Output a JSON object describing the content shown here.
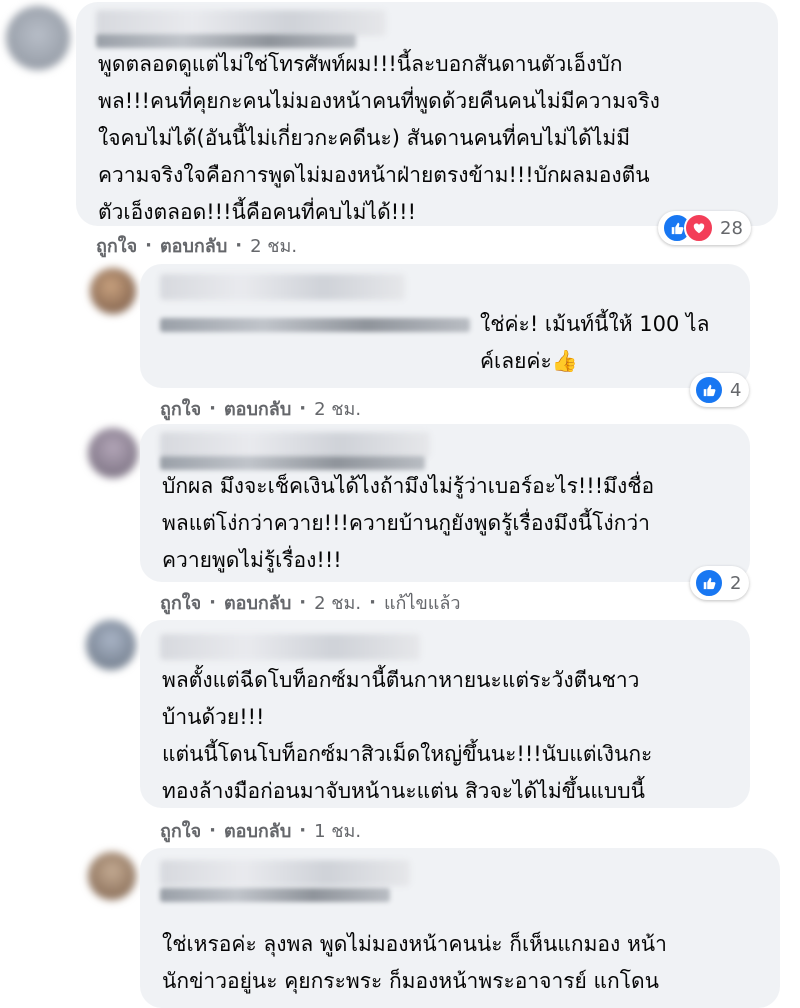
{
  "comments": [
    {
      "text": "พูดตลอดดูแต่ไม่ใช่โทรศัพท์ผม!!!นี้ละบอกสันดานตัวเอ็งบัก\nพล!!!คนที่คุยกะคนไม่มองหน้าคนที่พูดด้วยคืนคนไม่มีความจริง\nใจคบไม่ได้(อันนี้ไม่เกี่ยวกะคดีนะ) สันดานคนที่คบไม่ได้ไม่มี\nความจริงใจคือการพูดไม่มองหน้าฝ่ายตรงข้าม!!!บักผลมองตีน\nตัวเอ็งตลอด!!!นี้คือคนที่คบไม่ได้!!!",
      "reaction_count": "28",
      "like_label": "ถูกใจ",
      "reply_label": "ตอบกลับ",
      "time": "2 ชม.",
      "edited": ""
    },
    {
      "text": "ใช่ค่ะ! เม้นท์นี้ให้ 100 ไล\nค์เลยค่ะ👍",
      "reaction_count": "4",
      "like_label": "ถูกใจ",
      "reply_label": "ตอบกลับ",
      "time": "2 ชม.",
      "edited": ""
    },
    {
      "text": "บักผล มึงจะเช็คเงินได้ไงถ้ามึงไม่รู้ว่าเบอร์อะไร!!!มึงชื่อ\nพลแต่โง่กว่าควาย!!!ควายบ้านกูยังพูดรู้เรื่องมึงนี้โง่กว่า\nควายพูดไม่รู้เรื่อง!!!",
      "reaction_count": "2",
      "like_label": "ถูกใจ",
      "reply_label": "ตอบกลับ",
      "time": "2 ชม.",
      "edited": "แก้ไขแล้ว"
    },
    {
      "text": "พลตั้งแต่ฉีดโบท็อกซ์มานี้ตีนกาหายนะแต่ระวังตีนชาว\nบ้านด้วย!!!\nแต่นนี้โดนโบท็อกซ์มาสิวเม็ดใหญ่ขึ้นนะ!!!นับแต่เงินกะ\nทองล้างมือก่อนมาจับหน้านะแต่น สิวจะได้ไม่ขึ้นแบบนี้",
      "reaction_count": "",
      "like_label": "ถูกใจ",
      "reply_label": "ตอบกลับ",
      "time": "1 ชม.",
      "edited": ""
    },
    {
      "text": "ใช่เหรอค่ะ ลุงพล พูดไม่มองหน้าคนน่ะ ก็เห็นแกมอง หน้า\nนักข่าวอยู่นะ คุยกระพระ ก็มองหน้าพระอาจารย์ แกโดน",
      "reaction_count": "",
      "like_label": "",
      "reply_label": "",
      "time": "",
      "edited": ""
    }
  ],
  "colors": {
    "bubble": "#f0f2f5",
    "meta_text": "#65676b",
    "like_blue": "#1877f2",
    "love_red": "#f33e58"
  }
}
